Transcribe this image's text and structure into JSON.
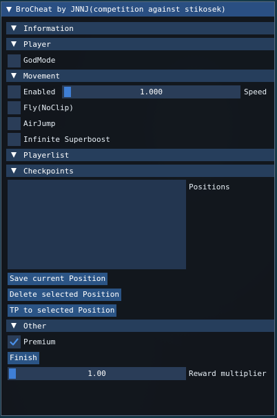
{
  "window": {
    "title": "BroCheat by JNNJ(competition against stikosek)"
  },
  "sections": {
    "information": "Information",
    "player": "Player",
    "movement": "Movement",
    "playerlist": "Playerlist",
    "checkpoints": "Checkpoints",
    "other": "Other"
  },
  "player": {
    "godmode_label": "GodMode",
    "godmode_checked": false
  },
  "movement": {
    "enabled_label": "Enabled",
    "enabled_checked": false,
    "speed_value": "1.000",
    "speed_label": "Speed",
    "fly_label": "Fly(NoClip)",
    "airjump_label": "AirJump",
    "superboost_label": "Infinite Superboost"
  },
  "checkpoints": {
    "positions_label": "Positions",
    "save_button": "Save current Position",
    "delete_button": "Delete selected Position",
    "tp_button": "TP to selected Position"
  },
  "other": {
    "premium_label": "Premium",
    "premium_checked": true,
    "finish_button": "Finish",
    "reward_value": "1.00",
    "reward_label": "Reward multiplier"
  },
  "colors": {
    "titlebar": "#2a4f82",
    "header": "#263e5c",
    "frame": "#2a3d58",
    "button": "#2b5485",
    "accent": "#3f7fd6"
  }
}
